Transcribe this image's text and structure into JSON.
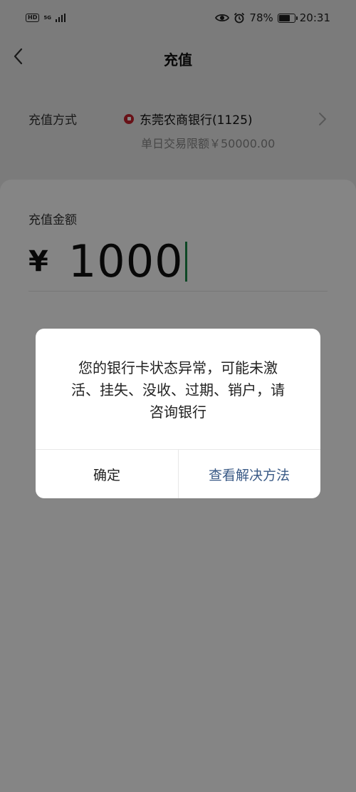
{
  "status_bar": {
    "hd": "HD",
    "network": "5G",
    "battery": "78%",
    "battery_level": 0.78,
    "time": "20:31"
  },
  "header": {
    "title": "充值"
  },
  "recharge_method": {
    "label": "充值方式",
    "bank_name": "东莞农商银行(1125)",
    "limit": "单日交易限额￥50000.00"
  },
  "amount": {
    "label": "充值金额",
    "currency": "¥",
    "value": "1000"
  },
  "dialog": {
    "message": "您的银行卡状态异常，可能未激活、挂失、没收、过期、销户，请咨询银行",
    "confirm_label": "确定",
    "solution_label": "查看解决方法"
  },
  "colors": {
    "dialog_link": "#3a5a86",
    "cursor": "#1c8a49",
    "bank_logo": "#c8212d"
  }
}
